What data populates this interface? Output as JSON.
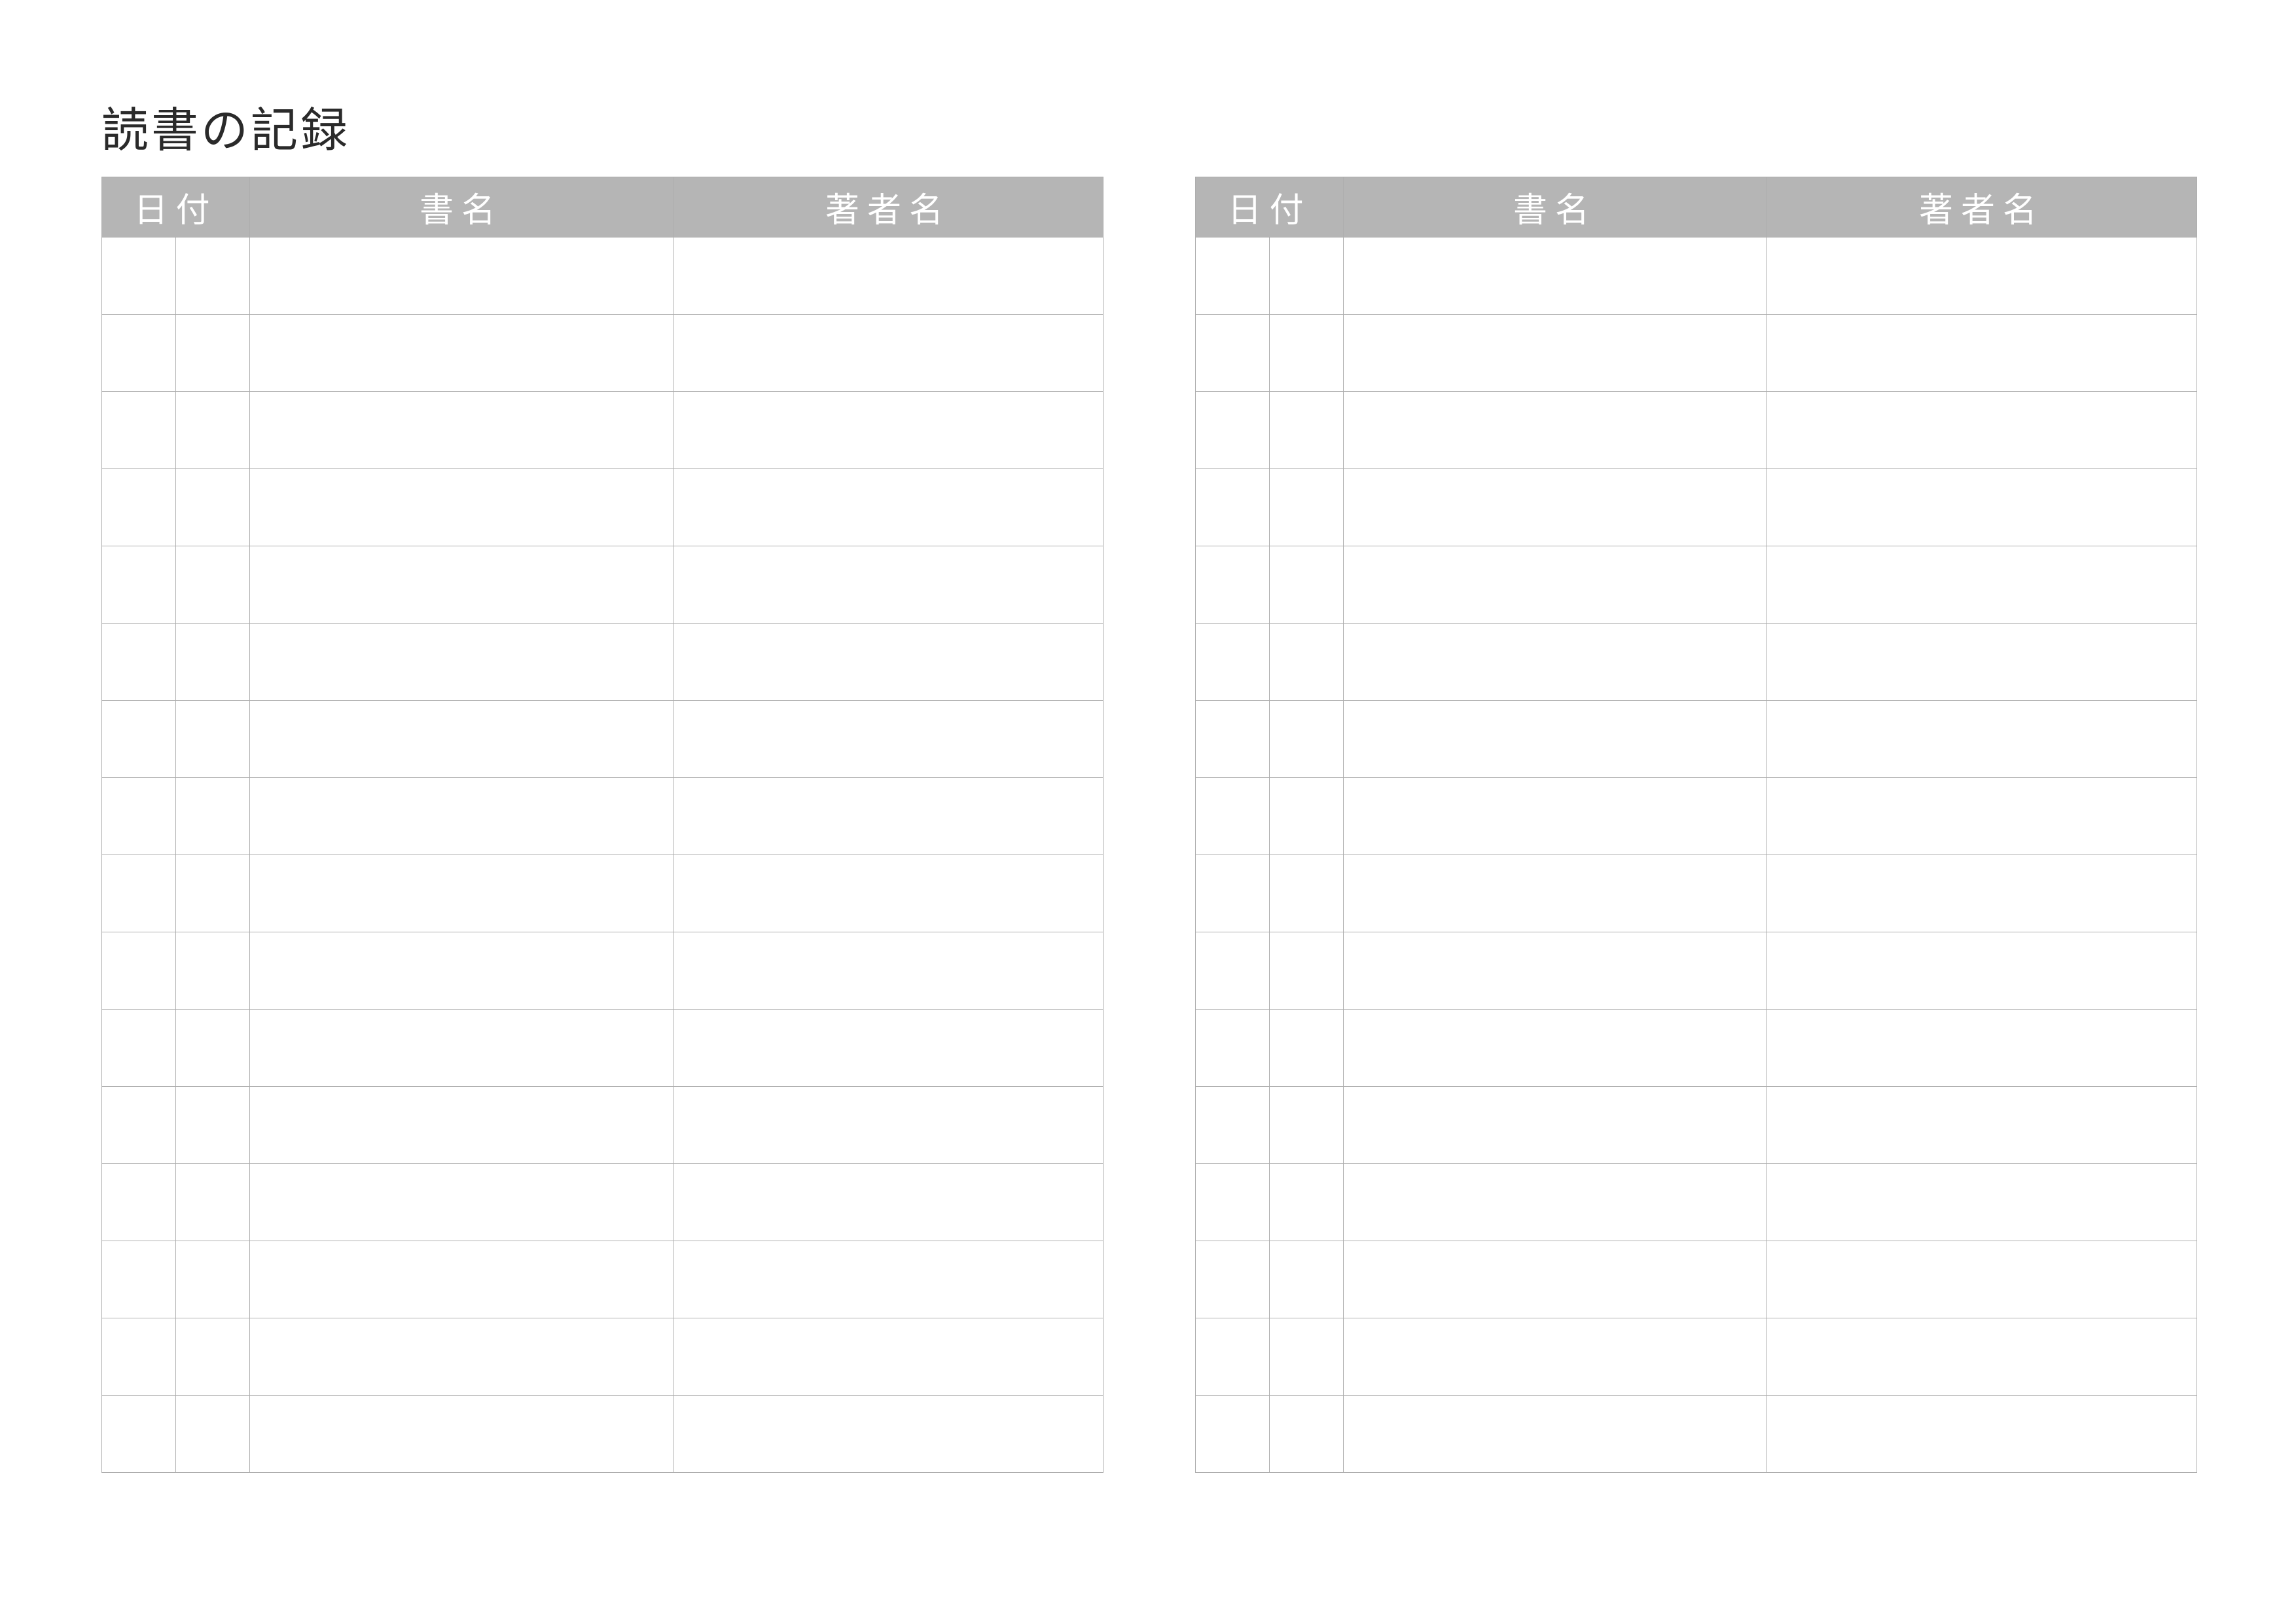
{
  "title": "読書の記録",
  "columns": {
    "date": "日付",
    "book_title": "書名",
    "author": "著者名"
  },
  "tables": {
    "left": {
      "row_count": 16,
      "rows": [
        {
          "date_a": "",
          "date_b": "",
          "title": "",
          "author": ""
        },
        {
          "date_a": "",
          "date_b": "",
          "title": "",
          "author": ""
        },
        {
          "date_a": "",
          "date_b": "",
          "title": "",
          "author": ""
        },
        {
          "date_a": "",
          "date_b": "",
          "title": "",
          "author": ""
        },
        {
          "date_a": "",
          "date_b": "",
          "title": "",
          "author": ""
        },
        {
          "date_a": "",
          "date_b": "",
          "title": "",
          "author": ""
        },
        {
          "date_a": "",
          "date_b": "",
          "title": "",
          "author": ""
        },
        {
          "date_a": "",
          "date_b": "",
          "title": "",
          "author": ""
        },
        {
          "date_a": "",
          "date_b": "",
          "title": "",
          "author": ""
        },
        {
          "date_a": "",
          "date_b": "",
          "title": "",
          "author": ""
        },
        {
          "date_a": "",
          "date_b": "",
          "title": "",
          "author": ""
        },
        {
          "date_a": "",
          "date_b": "",
          "title": "",
          "author": ""
        },
        {
          "date_a": "",
          "date_b": "",
          "title": "",
          "author": ""
        },
        {
          "date_a": "",
          "date_b": "",
          "title": "",
          "author": ""
        },
        {
          "date_a": "",
          "date_b": "",
          "title": "",
          "author": ""
        },
        {
          "date_a": "",
          "date_b": "",
          "title": "",
          "author": ""
        }
      ]
    },
    "right": {
      "row_count": 16,
      "rows": [
        {
          "date_a": "",
          "date_b": "",
          "title": "",
          "author": ""
        },
        {
          "date_a": "",
          "date_b": "",
          "title": "",
          "author": ""
        },
        {
          "date_a": "",
          "date_b": "",
          "title": "",
          "author": ""
        },
        {
          "date_a": "",
          "date_b": "",
          "title": "",
          "author": ""
        },
        {
          "date_a": "",
          "date_b": "",
          "title": "",
          "author": ""
        },
        {
          "date_a": "",
          "date_b": "",
          "title": "",
          "author": ""
        },
        {
          "date_a": "",
          "date_b": "",
          "title": "",
          "author": ""
        },
        {
          "date_a": "",
          "date_b": "",
          "title": "",
          "author": ""
        },
        {
          "date_a": "",
          "date_b": "",
          "title": "",
          "author": ""
        },
        {
          "date_a": "",
          "date_b": "",
          "title": "",
          "author": ""
        },
        {
          "date_a": "",
          "date_b": "",
          "title": "",
          "author": ""
        },
        {
          "date_a": "",
          "date_b": "",
          "title": "",
          "author": ""
        },
        {
          "date_a": "",
          "date_b": "",
          "title": "",
          "author": ""
        },
        {
          "date_a": "",
          "date_b": "",
          "title": "",
          "author": ""
        },
        {
          "date_a": "",
          "date_b": "",
          "title": "",
          "author": ""
        },
        {
          "date_a": "",
          "date_b": "",
          "title": "",
          "author": ""
        }
      ]
    }
  }
}
